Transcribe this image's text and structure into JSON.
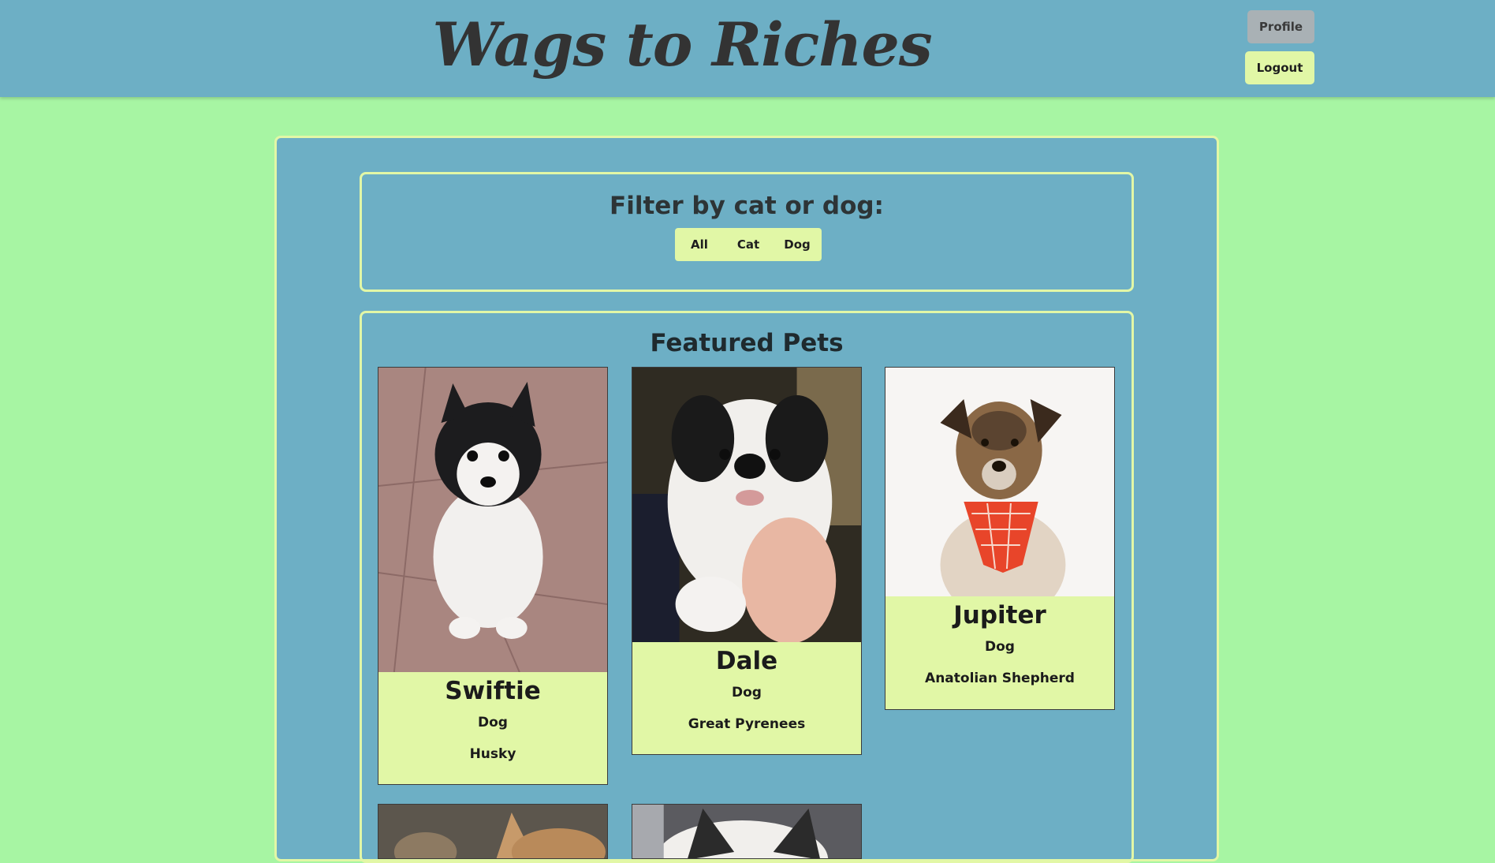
{
  "header": {
    "title": "Wags to Riches",
    "profile_label": "Profile",
    "logout_label": "Logout"
  },
  "filter": {
    "title": "Filter by cat or dog:",
    "options": [
      "All",
      "Cat",
      "Dog"
    ]
  },
  "featured": {
    "title": "Featured Pets",
    "pets": [
      {
        "name": "Swiftie",
        "species": "Dog",
        "breed": "Husky"
      },
      {
        "name": "Dale",
        "species": "Dog",
        "breed": "Great Pyrenees"
      },
      {
        "name": "Jupiter",
        "species": "Dog",
        "breed": "Anatolian Shepherd"
      }
    ]
  },
  "colors": {
    "page_background": "#a7f5a3",
    "panel_background": "#6dafc5",
    "accent": "#e1f7a6",
    "profile_button": "#a9b1b5"
  }
}
